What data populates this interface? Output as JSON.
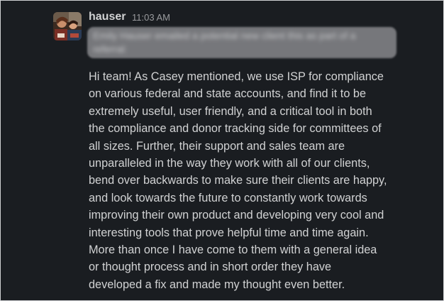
{
  "message": {
    "author": "hauser",
    "timestamp": "11:03 AM",
    "quoted_intro_redacted": "Emily Hauser emailed a potential new client this as part of a referral:",
    "body_lines": [
      "Hi team! As Casey mentioned, we use ISP for compliance",
      "on various federal and state accounts, and find it to be",
      "extremely useful, user friendly, and a critical tool in both",
      "the compliance and donor tracking side for committees of",
      "all sizes. Further, their support and sales team are",
      "unparalleled in the way they work with all of our clients,",
      "bend over backwards to make sure their clients are happy,",
      "and look towards the future to constantly work towards",
      "improving their own product and developing very cool and",
      "interesting tools that prove helpful time and time again.",
      "More than once I have come to them with a general idea",
      "or thought process and in short order they have",
      "developed a fix and made my thought even better."
    ]
  },
  "colors": {
    "background": "#1a1d21",
    "text": "#d1d2d3",
    "timestamp": "#9a9b9e",
    "redaction": "#76777b"
  }
}
